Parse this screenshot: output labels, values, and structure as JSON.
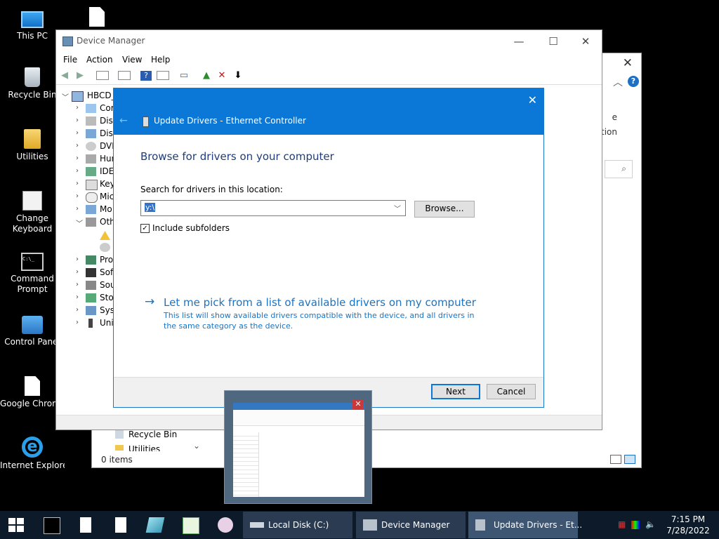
{
  "desktop": {
    "icons": [
      {
        "label": "This PC"
      },
      {
        "label": "Recycle Bin"
      },
      {
        "label": "Utilities"
      },
      {
        "label": "Change Keyboard Layout"
      },
      {
        "label": "Command Prompt"
      },
      {
        "label": "Control Panel"
      },
      {
        "label": "Google Chrome"
      },
      {
        "label": "Internet Explorer"
      }
    ]
  },
  "explorer": {
    "ribbon_text_1": "e",
    "ribbon_text_2": "tion",
    "nav_items": [
      "Recycle Bin",
      "Utilities"
    ],
    "status": "0 items"
  },
  "device_manager": {
    "title": "Device Manager",
    "menu": [
      "File",
      "Action",
      "View",
      "Help"
    ],
    "tree": {
      "root": "HBCD_",
      "items": [
        "Cor",
        "Disk",
        "Disp",
        "DVD",
        "Hun",
        "IDE",
        "Key",
        "Mic",
        "Mo",
        "Oth",
        "",
        "",
        "Pro",
        "Soft",
        "Sou",
        "Sto",
        "Syst",
        "Uni"
      ]
    }
  },
  "dialog": {
    "title": "Update Drivers - Ethernet Controller",
    "heading": "Browse for drivers on your computer",
    "search_label": "Search for drivers in this location:",
    "path_value": "y:\\",
    "browse_label": "Browse...",
    "include_subfolders_label": "Include subfolders",
    "include_subfolders_checked": true,
    "pick_link": "Let me pick from a list of available drivers on my computer",
    "pick_desc": "This list will show available drivers compatible with the device, and all drivers in the same category as the device.",
    "next_label": "Next",
    "cancel_label": "Cancel"
  },
  "taskbar": {
    "tasks": [
      {
        "label": "Local Disk (C:)"
      },
      {
        "label": "Device Manager"
      },
      {
        "label": "Update Drivers - Et..."
      }
    ],
    "clock_time": "7:15 PM",
    "clock_date": "7/28/2022"
  },
  "colors": {
    "dialog_header": "#0b78d7",
    "link": "#1b73c3",
    "heading": "#1f3d7a",
    "taskbar": "#0d1a2a"
  }
}
